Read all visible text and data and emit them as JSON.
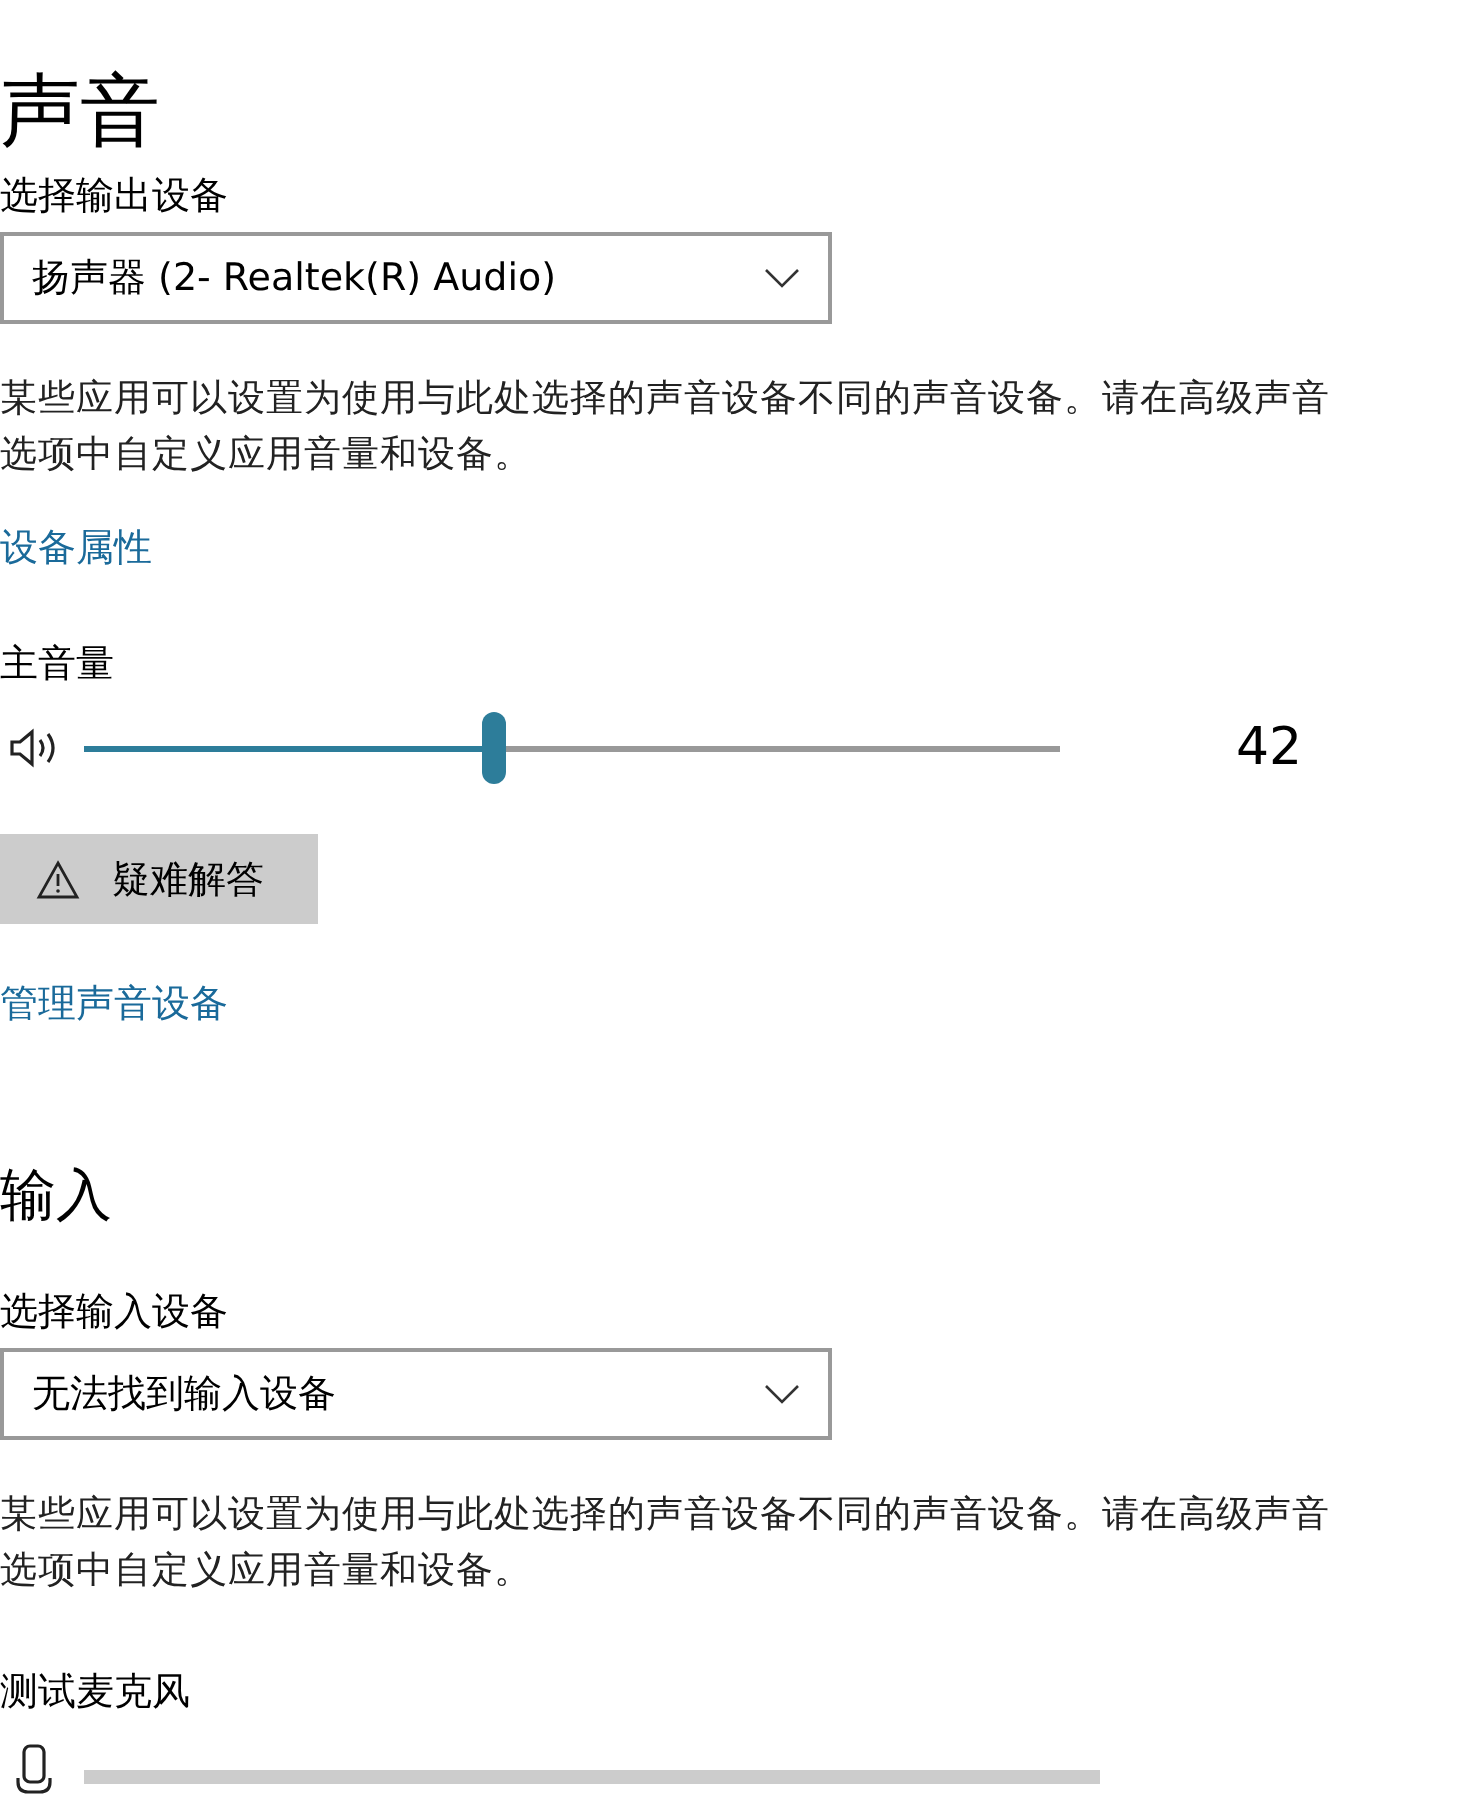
{
  "title": "声音",
  "output": {
    "label": "选择输出设备",
    "device": "扬声器 (2- Realtek(R) Audio)",
    "description": "某些应用可以设置为使用与此处选择的声音设备不同的声音设备。请在高级声音选项中自定义应用音量和设备。",
    "properties_link": "设备属性"
  },
  "master_volume": {
    "label": "主音量",
    "level": 0.42,
    "reading": "42"
  },
  "troubleshoot_button": "疑难解答",
  "manage_link": "管理声音设备",
  "input": {
    "heading": "输入",
    "label": "选择输入设备",
    "device": "无法找到输入设备",
    "description": "某些应用可以设置为使用与此处选择的声音设备不同的声音设备。请在高级声音选项中自定义应用音量和设备。",
    "test_label": "测试麦克风",
    "mic_meter": {
      "level": 0
    }
  }
}
